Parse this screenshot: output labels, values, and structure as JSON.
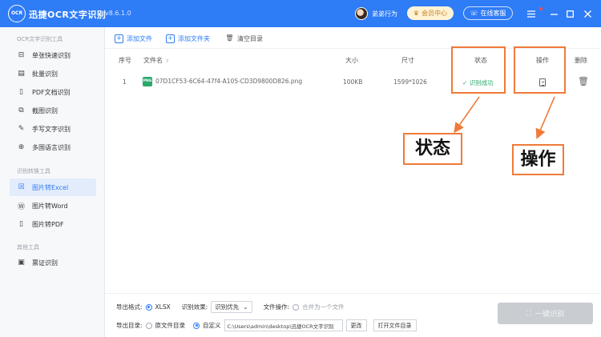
{
  "app": {
    "logo_text": "OCR",
    "title": "迅捷OCR文字识别",
    "version": "v8.6.1.0",
    "username": "弟弟行为",
    "member_label": "会员中心",
    "service_label": "在线客服",
    "menu_icon": "hamburger-icon",
    "minimize_icon": "minimize-icon",
    "maximize_icon": "maximize-icon",
    "close_icon": "close-icon",
    "accent_color": "#2e7cf6"
  },
  "sidebar": {
    "groups": [
      {
        "title": "OCR文字识别工具",
        "items": [
          {
            "label": "单张快速识别",
            "icon": "scan-icon",
            "active": false
          },
          {
            "label": "批量识别",
            "icon": "batch-icon",
            "active": false
          },
          {
            "label": "PDF文档识别",
            "icon": "pdf-icon",
            "active": false
          },
          {
            "label": "截图识别",
            "icon": "screenshot-icon",
            "active": false
          },
          {
            "label": "手写文字识别",
            "icon": "handwriting-icon",
            "active": false
          },
          {
            "label": "多国语言识别",
            "icon": "globe-icon",
            "active": false
          }
        ]
      },
      {
        "title": "识别转换工具",
        "items": [
          {
            "label": "图片转Excel",
            "icon": "excel-icon",
            "active": true
          },
          {
            "label": "图片转Word",
            "icon": "word-icon",
            "active": false
          },
          {
            "label": "图片转PDF",
            "icon": "pdf-icon",
            "active": false
          }
        ]
      },
      {
        "title": "其他工具",
        "items": [
          {
            "label": "票证识别",
            "icon": "ticket-icon",
            "active": false
          }
        ]
      }
    ]
  },
  "toolbar": {
    "add_file": "添加文件",
    "add_folder": "添加文件夹",
    "clear_list": "清空目录"
  },
  "table": {
    "headers": {
      "index": "序号",
      "filename": "文件名",
      "size": "大小",
      "dimensions": "尺寸",
      "status": "状态",
      "action": "操作",
      "delete": "删除"
    },
    "rows": [
      {
        "index": "1",
        "file_type": "PNG",
        "filename": "07D1CF53-6C64-47f4-A105-CD3D9800D826.png",
        "size": "100KB",
        "dimensions": "1599*1026",
        "status": "识别成功"
      }
    ]
  },
  "annotations": {
    "status_label": "状态",
    "action_label": "操作",
    "color": "#f07a3a"
  },
  "bottom": {
    "export_format_label": "导出格式:",
    "format_value": "XLSX",
    "effect_label": "识别效果:",
    "effect_value": "识别优先",
    "file_op_label": "文件操作:",
    "merge_label": "合并为一个文件",
    "export_dir_label": "导出目录:",
    "original_dir": "原文件目录",
    "custom_dir": "自定义",
    "path_value": "C:\\Users\\admin\\desktop\\迅捷OCR文字识别",
    "change_button": "更改",
    "open_folder_button": "打开文件目录",
    "start_button": "一键识别"
  }
}
